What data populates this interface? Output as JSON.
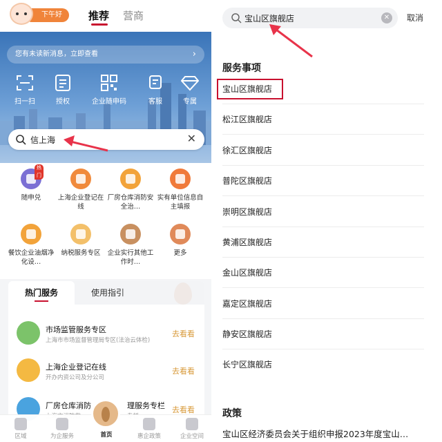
{
  "left": {
    "header": {
      "greeting": "下午好",
      "tabs": [
        "推荐",
        "营商"
      ],
      "active_tab": "推荐"
    },
    "notice": "您有未读新消息，立即查看",
    "quick_actions": [
      {
        "label": "扫一扫",
        "icon": "scan-icon"
      },
      {
        "label": "授权",
        "icon": "authorize-icon"
      },
      {
        "label": "企业随申码",
        "icon": "qrcode-icon"
      },
      {
        "label": "客服",
        "icon": "customer-service-icon"
      },
      {
        "label": "专属",
        "icon": "diamond-icon"
      }
    ],
    "search": {
      "value": "信上海"
    },
    "services": [
      {
        "label": "随申兑",
        "badge": "热门",
        "color": "#7b6fd4"
      },
      {
        "label": "上海企业登记在线",
        "color": "#f08a3c"
      },
      {
        "label": "厂房仓库消防安全治…",
        "color": "#f2a33a"
      },
      {
        "label": "实有单位信息自主填报",
        "color": "#f07a3a"
      },
      {
        "label": "餐饮企业油烟净化设…",
        "color": "#f2a33a"
      },
      {
        "label": "纳税服务专区",
        "color": "#f3c06a"
      },
      {
        "label": "企业实行其他工作时…",
        "color": "#c89060"
      },
      {
        "label": "更多",
        "color": "#e08a5a"
      }
    ],
    "hot_tabs": [
      "热门服务",
      "使用指引"
    ],
    "hot_services": [
      {
        "title": "市场监管服务专区",
        "subtitle": "上海市市场监督管理局专区(法治云体检)",
        "action": "去看看",
        "color": "#7cc36a"
      },
      {
        "title": "上海企业登记在线",
        "subtitle": "开办内资公司及分公司",
        "action": "去看看",
        "color": "#f4b942"
      },
      {
        "title": "厂房仓库消防",
        "title_tail": "理服务专栏",
        "subtitle": "上海市消防救",
        "subtitle_tail": "专栏",
        "action": "去看看",
        "color": "#4aa3df"
      }
    ],
    "bottom_nav": [
      {
        "label": "区域",
        "active": false
      },
      {
        "label": "为企服务",
        "active": false
      },
      {
        "label": "首页",
        "active": true
      },
      {
        "label": "惠企政策",
        "active": false
      },
      {
        "label": "企业空间",
        "active": false
      }
    ]
  },
  "right": {
    "search": {
      "value": "宝山区旗舰店",
      "cancel": "取消"
    },
    "section_services": "服务事项",
    "results": [
      "宝山区旗舰店",
      "松江区旗舰店",
      "徐汇区旗舰店",
      "普陀区旗舰店",
      "崇明区旗舰店",
      "黄浦区旗舰店",
      "金山区旗舰店",
      "嘉定区旗舰店",
      "静安区旗舰店",
      "长宁区旗舰店"
    ],
    "section_policy": "政策",
    "policy_item": "宝山区经济委员会关于组织申报2023年度宝山…"
  },
  "colors": {
    "accent": "#c8102e",
    "annotation_arrow": "#e8334a",
    "go_link": "#d89a3a"
  }
}
